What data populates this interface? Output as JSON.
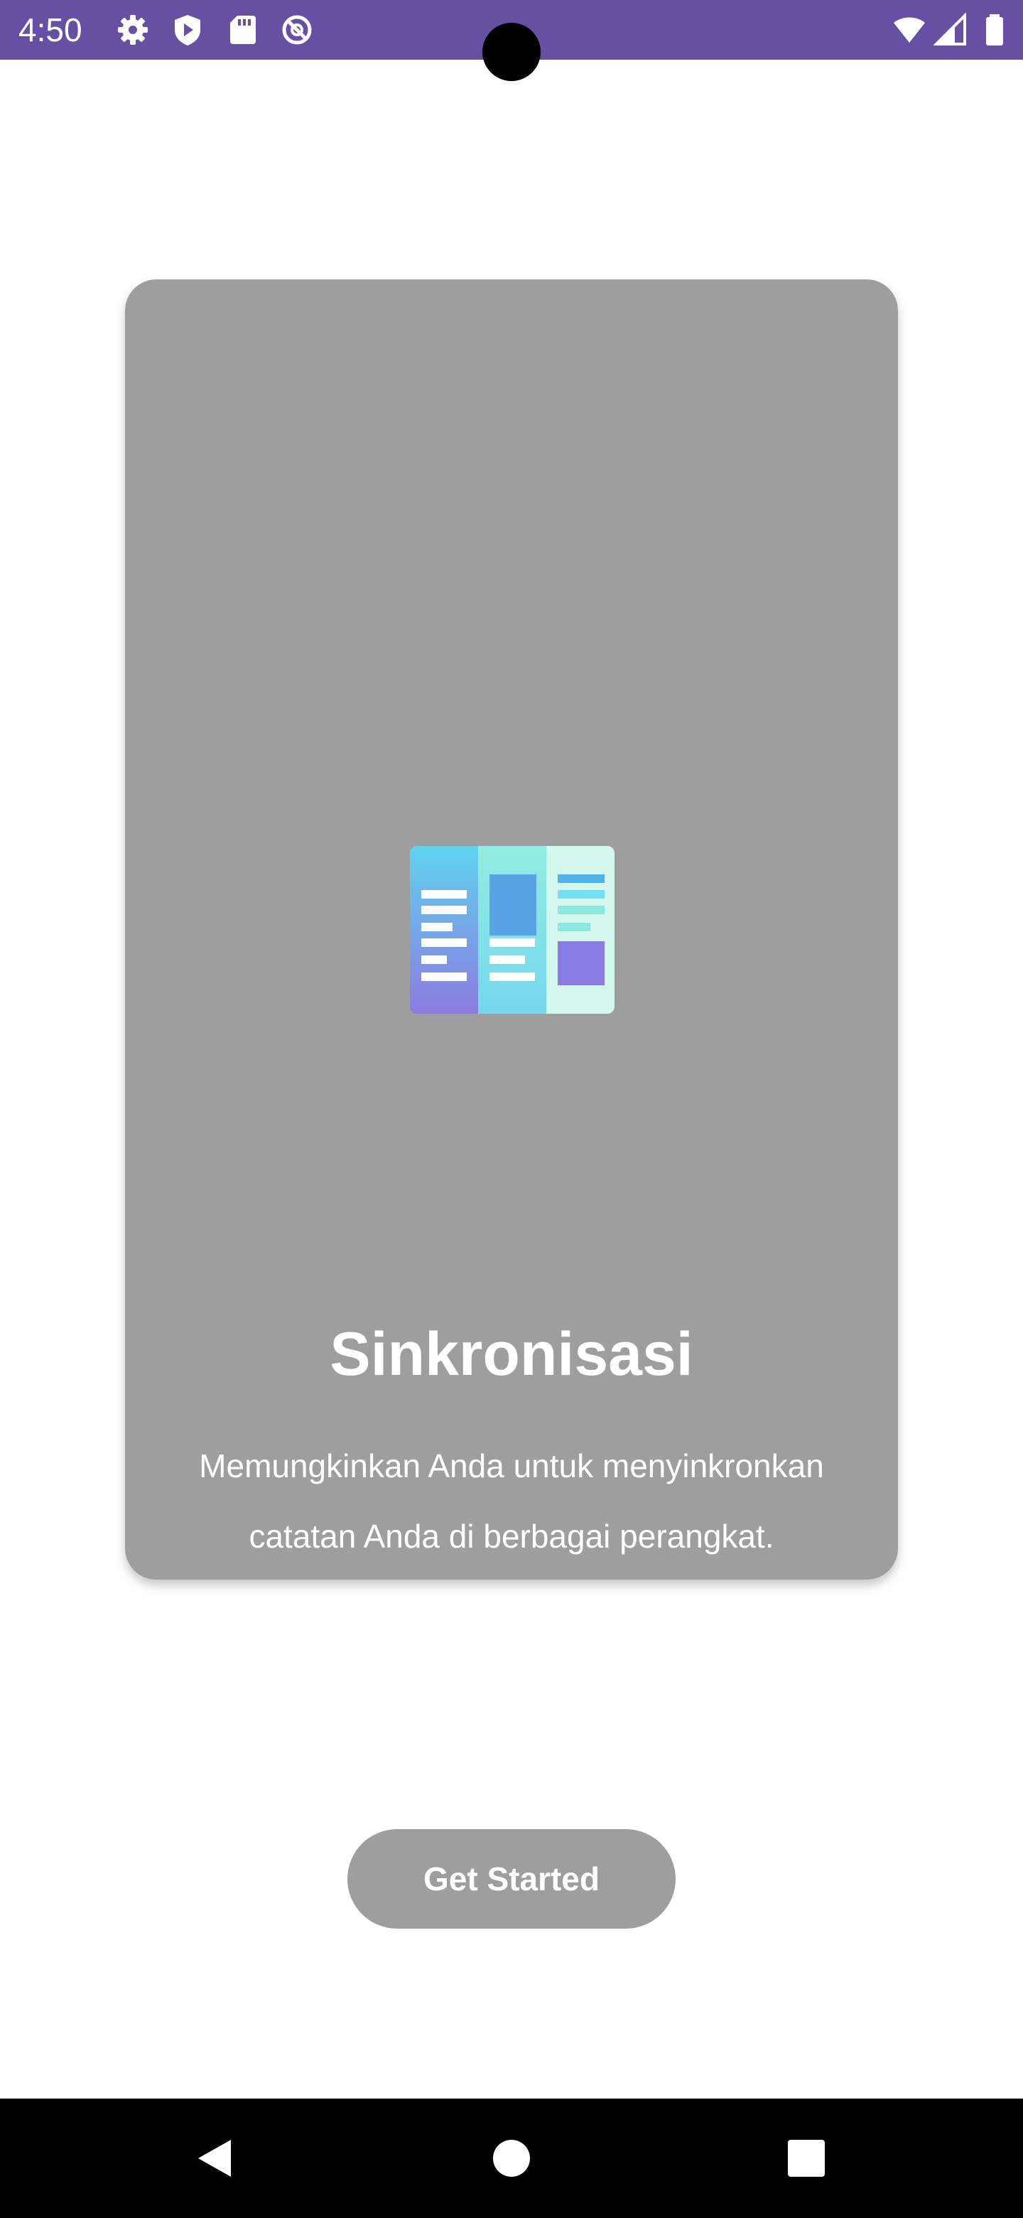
{
  "status_bar": {
    "time": "4:50",
    "left_icons": [
      "gear-icon",
      "shield-play-icon",
      "sd-card-icon",
      "at-sign-circle-icon"
    ],
    "right_icons": [
      "wifi-icon",
      "cell-signal-icon",
      "battery-icon"
    ],
    "color": "#6750a4"
  },
  "onboarding_card": {
    "illustration": "notes-sync-illustration",
    "title": "Sinkronisasi",
    "description": "Memungkinkan Anda untuk menyinkronkan catatan Anda di berbagai perangkat.",
    "background": "#9e9e9e"
  },
  "cta": {
    "label": "Get Started"
  },
  "nav_bar": {
    "buttons": [
      "back-icon",
      "home-icon",
      "recents-icon"
    ]
  }
}
